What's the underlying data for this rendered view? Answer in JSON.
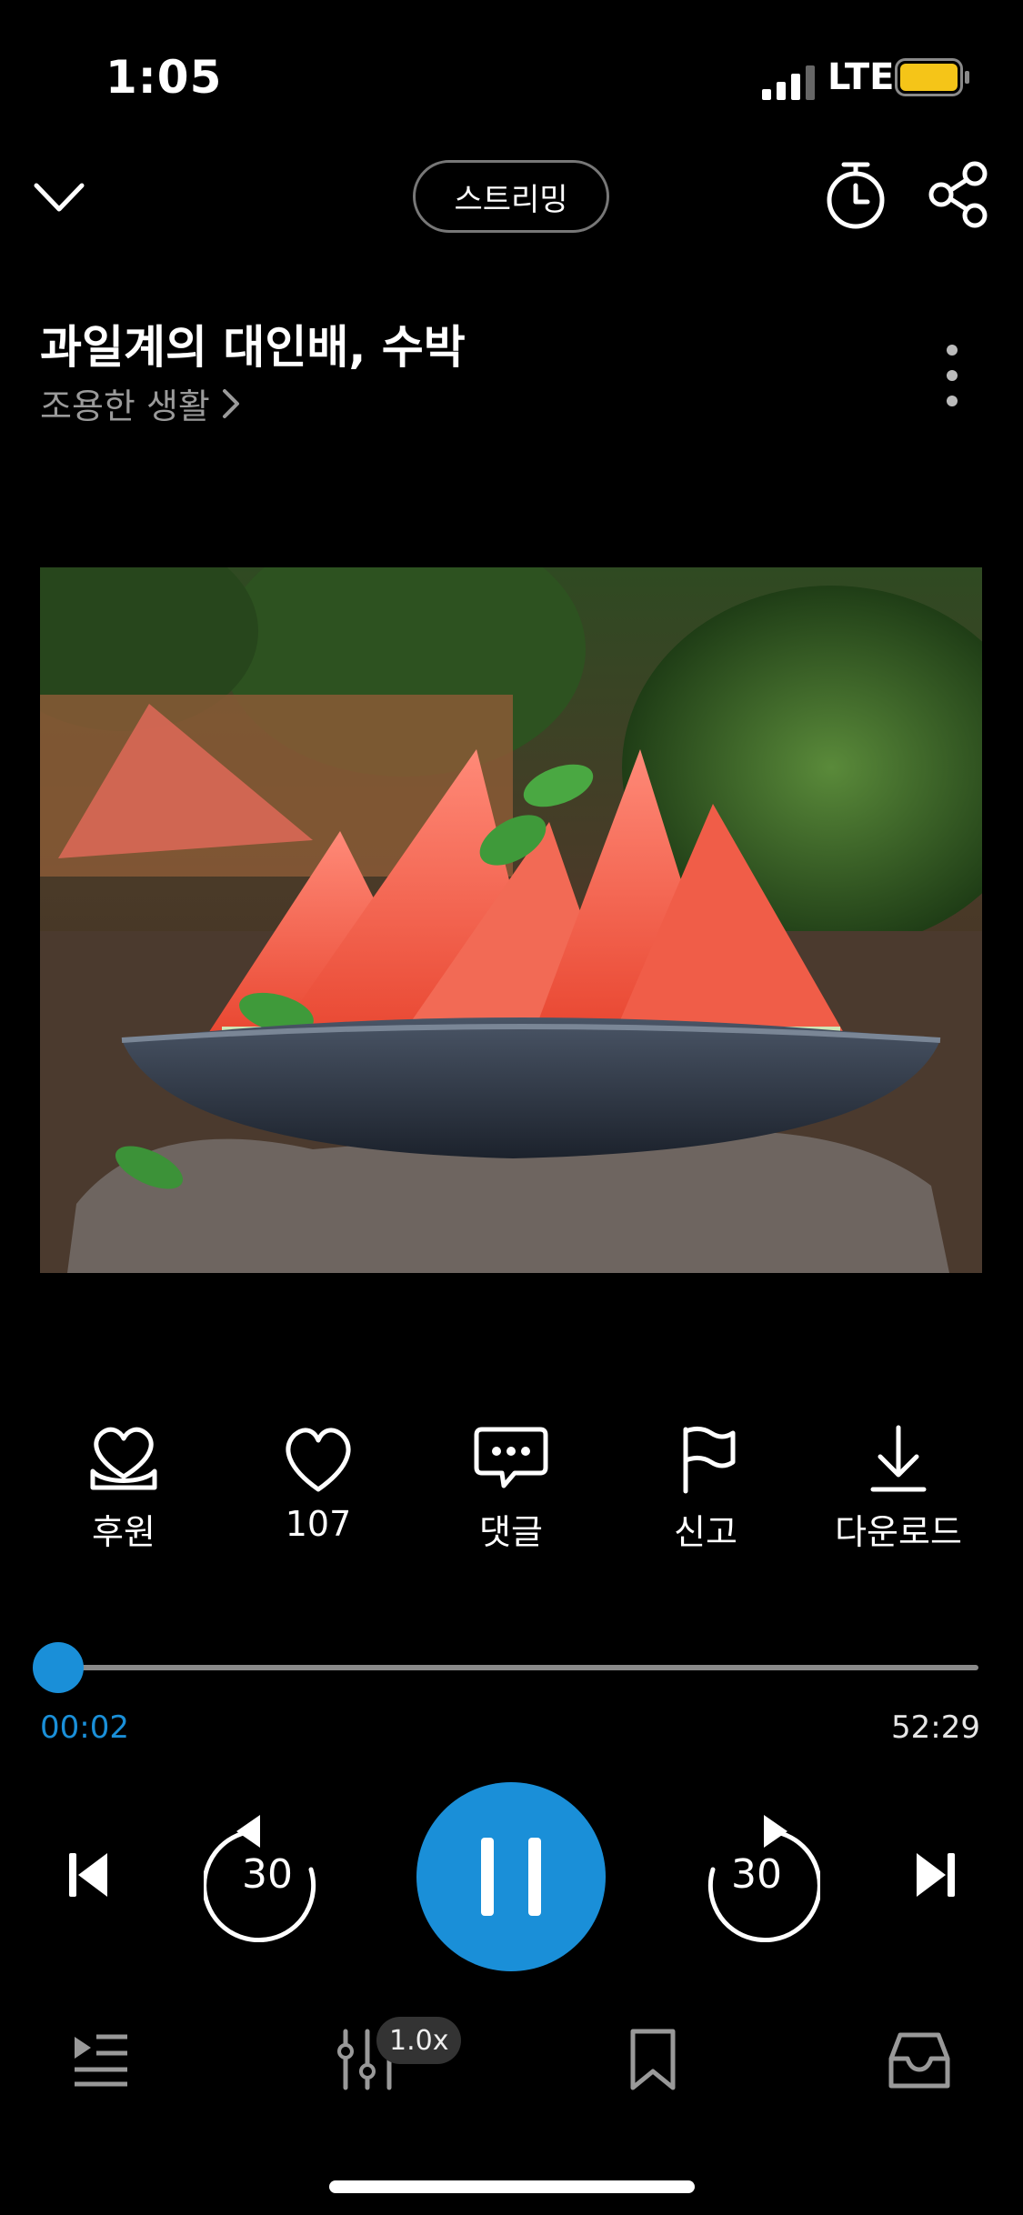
{
  "status_bar": {
    "time": "1:05",
    "network": "LTE"
  },
  "header": {
    "mode_label": "스트리밍"
  },
  "episode": {
    "title": "과일계의 대인배, 수박",
    "channel": "조용한 생활",
    "channel_chevron": ">"
  },
  "artwork": {
    "alt": "수박"
  },
  "actions": [
    {
      "icon": "gift-heart-icon",
      "label": "후원"
    },
    {
      "icon": "heart-icon",
      "label": "107"
    },
    {
      "icon": "comment-icon",
      "label": "댓글"
    },
    {
      "icon": "flag-icon",
      "label": "신고"
    },
    {
      "icon": "download-icon",
      "label": "다운로드"
    }
  ],
  "player": {
    "elapsed": "00:02",
    "duration": "52:29",
    "progress": 0.0006,
    "rewind_seconds": "30",
    "forward_seconds": "30",
    "speed": "1.0x"
  },
  "colors": {
    "accent": "#1a8fd8",
    "background": "#000000",
    "muted": "#9a9a9a"
  }
}
